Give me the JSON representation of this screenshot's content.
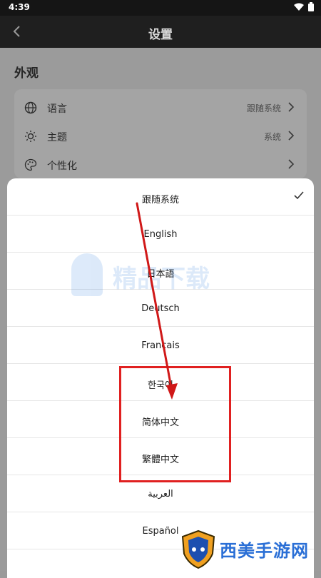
{
  "status_bar": {
    "time": "4:39"
  },
  "app_bar": {
    "title": "设置"
  },
  "settings": {
    "section_title": "外观",
    "rows": [
      {
        "label": "语言",
        "value": "跟随系统",
        "icon": "globe-icon"
      },
      {
        "label": "主题",
        "value": "系统",
        "icon": "sun-icon"
      },
      {
        "label": "个性化",
        "value": "",
        "icon": "palette-icon"
      }
    ]
  },
  "language_sheet": {
    "selected": "跟随系统",
    "options": [
      "跟随系统",
      "English",
      "日本語",
      "Deutsch",
      "Français",
      "한국어",
      "简体中文",
      "繁體中文",
      "العربية",
      "Español"
    ]
  },
  "watermarks": {
    "center": "精品下载",
    "corner": "西美手游网"
  },
  "colors": {
    "highlight": "#e02020",
    "watermark_blue": "#2a6fd6"
  }
}
